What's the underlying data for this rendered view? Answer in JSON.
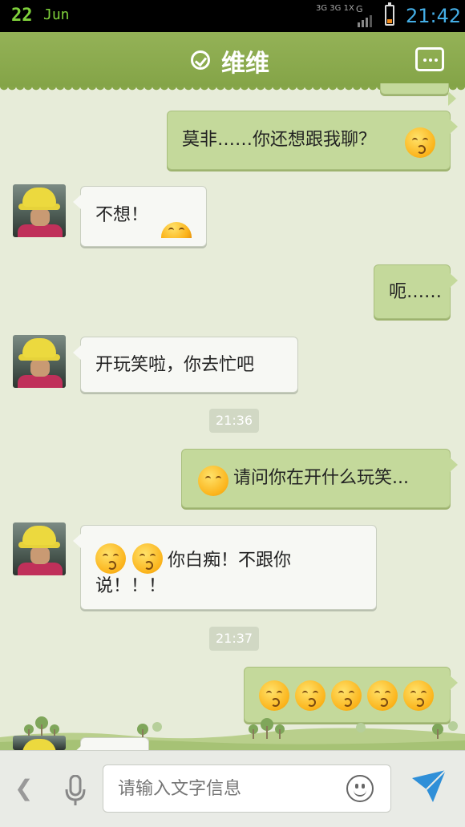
{
  "status_bar": {
    "date_day": "22",
    "date_month": "Jun",
    "network": "3G 3G 1X",
    "network_g": "G",
    "time": "21:42",
    "battery_level": 0.2
  },
  "title_bar": {
    "title": "维维",
    "check_icon": "check-circle-icon",
    "menu_icon": "more-menu-icon"
  },
  "messages": [
    {
      "side": "out",
      "text": "莫非……你还想跟我聊？",
      "emoji": "worried-emoji"
    },
    {
      "side": "in",
      "text": "不想！",
      "emoji": "peek-emoji"
    },
    {
      "side": "out",
      "text": "呃……"
    },
    {
      "side": "in",
      "text": "开玩笑啦，你去忙吧"
    },
    {
      "side": "time",
      "text": "21:36"
    },
    {
      "side": "out",
      "text": "请问你在开什么玩笑...",
      "emoji": "sweat-emoji"
    },
    {
      "side": "in",
      "text_line1": "你白痴！不跟你",
      "text_line2": "说！！！",
      "emoji": "angry-emoji"
    },
    {
      "side": "time",
      "text": "21:37"
    },
    {
      "side": "out",
      "emoji": "kiss-emoji",
      "emoji_count": 5
    }
  ],
  "input_bar": {
    "placeholder": "请输入文字信息",
    "back_icon": "chevron-left-icon",
    "voice_icon": "microphone-icon",
    "emoji_icon": "smiley-icon",
    "send_icon": "send-icon"
  },
  "colors": {
    "title_bar": "#8cab4f",
    "chat_background": "#e7ecd9",
    "outgoing_bubble": "#c4d99b",
    "incoming_bubble": "#f7f8f4",
    "time_accent": "#44aee6",
    "date_accent": "#7fd13b"
  }
}
